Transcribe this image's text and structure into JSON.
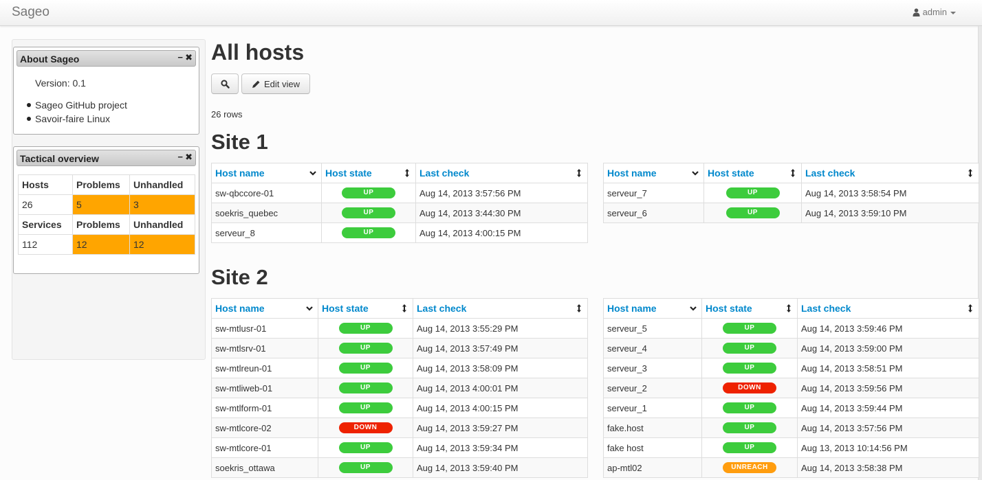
{
  "app": {
    "brand": "Sageo",
    "user": "admin"
  },
  "colors": {
    "up": "#3dcc3d",
    "down": "#ee2200",
    "unreach": "#ff9d0f",
    "problem": "#ffa500",
    "link": "#0088cc"
  },
  "about": {
    "title": "About Sageo",
    "version": "Version: 0.1",
    "links": [
      "Sageo GitHub project",
      "Savoir-faire Linux"
    ]
  },
  "tactical": {
    "title": "Tactical overview",
    "hosts_row": [
      "Hosts",
      "Problems",
      "Unhandled"
    ],
    "hosts_values": [
      "26",
      "5",
      "3"
    ],
    "services_row": [
      "Services",
      "Problems",
      "Unhandled"
    ],
    "services_values": [
      "112",
      "12",
      "12"
    ]
  },
  "main": {
    "title": "All hosts",
    "edit_view_label": "Edit view",
    "rows_count": "26 rows"
  },
  "table_headers": [
    "Host name",
    "Host state",
    "Last check"
  ],
  "sites": [
    {
      "title": "Site 1",
      "left": [
        {
          "host": "sw-qbccore-01",
          "state": "UP",
          "check": "Aug 14, 2013 3:57:56 PM"
        },
        {
          "host": "soekris_quebec",
          "state": "UP",
          "check": "Aug 14, 2013 3:44:30 PM"
        },
        {
          "host": "serveur_8",
          "state": "UP",
          "check": "Aug 14, 2013 4:00:15 PM"
        }
      ],
      "right": [
        {
          "host": "serveur_7",
          "state": "UP",
          "check": "Aug 14, 2013 3:58:54 PM"
        },
        {
          "host": "serveur_6",
          "state": "UP",
          "check": "Aug 14, 2013 3:59:10 PM"
        }
      ]
    },
    {
      "title": "Site 2",
      "left": [
        {
          "host": "sw-mtlusr-01",
          "state": "UP",
          "check": "Aug 14, 2013 3:55:29 PM"
        },
        {
          "host": "sw-mtlsrv-01",
          "state": "UP",
          "check": "Aug 14, 2013 3:57:49 PM"
        },
        {
          "host": "sw-mtlreun-01",
          "state": "UP",
          "check": "Aug 14, 2013 3:58:09 PM"
        },
        {
          "host": "sw-mtliweb-01",
          "state": "UP",
          "check": "Aug 14, 2013 4:00:01 PM"
        },
        {
          "host": "sw-mtlform-01",
          "state": "UP",
          "check": "Aug 14, 2013 4:00:15 PM"
        },
        {
          "host": "sw-mtlcore-02",
          "state": "DOWN",
          "check": "Aug 14, 2013 3:59:27 PM"
        },
        {
          "host": "sw-mtlcore-01",
          "state": "UP",
          "check": "Aug 14, 2013 3:59:34 PM"
        },
        {
          "host": "soekris_ottawa",
          "state": "UP",
          "check": "Aug 14, 2013 3:59:40 PM"
        }
      ],
      "right": [
        {
          "host": "serveur_5",
          "state": "UP",
          "check": "Aug 14, 2013 3:59:46 PM"
        },
        {
          "host": "serveur_4",
          "state": "UP",
          "check": "Aug 14, 2013 3:59:00 PM"
        },
        {
          "host": "serveur_3",
          "state": "UP",
          "check": "Aug 14, 2013 3:58:51 PM"
        },
        {
          "host": "serveur_2",
          "state": "DOWN",
          "check": "Aug 14, 2013 3:59:56 PM"
        },
        {
          "host": "serveur_1",
          "state": "UP",
          "check": "Aug 14, 2013 3:59:44 PM"
        },
        {
          "host": "fake.host",
          "state": "UP",
          "check": "Aug 14, 2013 3:57:56 PM"
        },
        {
          "host": "fake host",
          "state": "UP",
          "check": "Aug 13, 2013 10:14:56 PM"
        },
        {
          "host": "ap-mtl02",
          "state": "UNREACH",
          "check": "Aug 14, 2013 3:58:38 PM"
        }
      ]
    }
  ]
}
